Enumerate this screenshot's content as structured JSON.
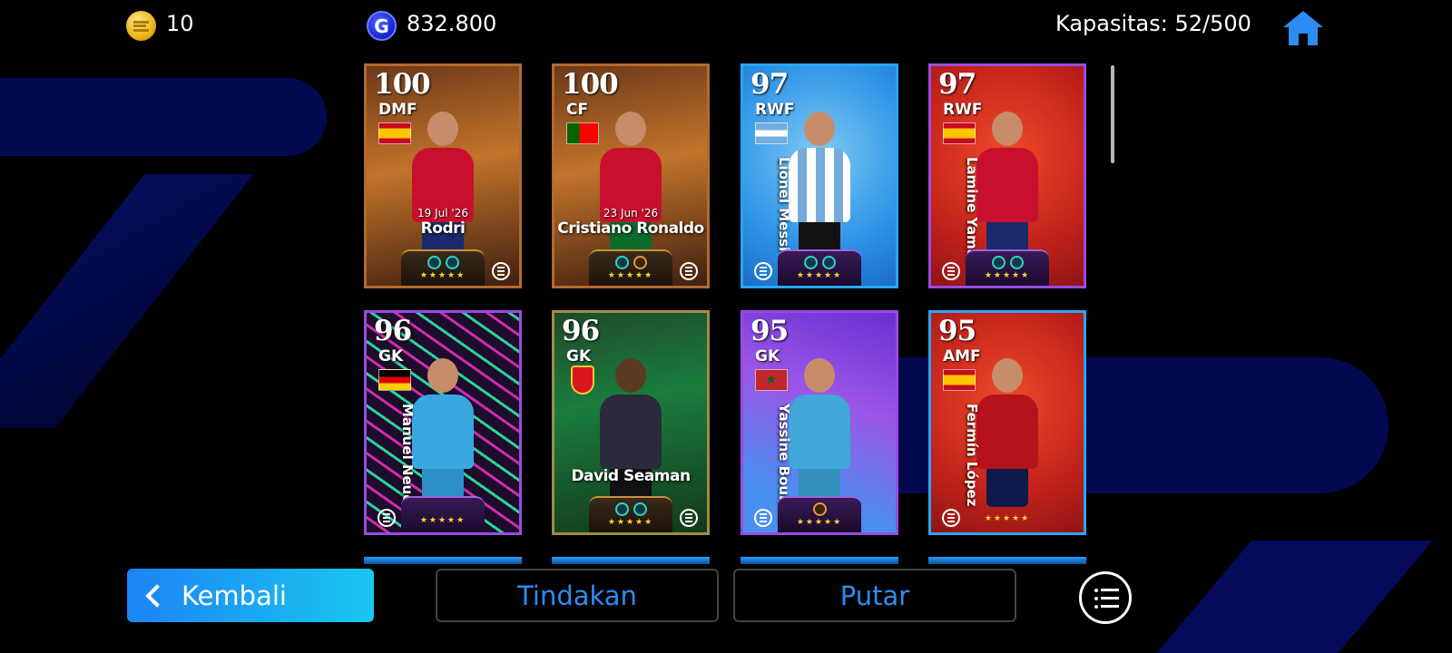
{
  "currency": {
    "coins_icon": "ecoin-icon",
    "coins": "10",
    "gp_icon_letter": "G",
    "gp": "832.800"
  },
  "capacity": "Kapasitas: 52/500",
  "cards": [
    {
      "rating": "100",
      "position": "DMF",
      "name": "Rodri",
      "date": "19 Jul '26",
      "country": "spain"
    },
    {
      "rating": "100",
      "position": "CF",
      "name": "Cristiano Ronaldo",
      "date": "23 Jun '26",
      "country": "portugal"
    },
    {
      "rating": "97",
      "position": "RWF",
      "name": "Lionel Messi",
      "country": "argentina"
    },
    {
      "rating": "97",
      "position": "RWF",
      "name": "Lamine Yamal",
      "country": "spain"
    },
    {
      "rating": "96",
      "position": "GK",
      "name": "Manuel Neuer",
      "country": "germany"
    },
    {
      "rating": "96",
      "position": "GK",
      "name": "David Seaman",
      "club": "arsenal"
    },
    {
      "rating": "95",
      "position": "GK",
      "name": "Yassine Bounou",
      "country": "morocco"
    },
    {
      "rating": "95",
      "position": "AMF",
      "name": "Fermín López",
      "country": "spain"
    }
  ],
  "stars": "★★★★★",
  "buttons": {
    "back": "Kembali",
    "actions": "Tindakan",
    "spin": "Putar"
  },
  "colors": {
    "accent": "#2c8cf2",
    "back_start": "#1c84f5",
    "back_end": "#19c7ef"
  }
}
